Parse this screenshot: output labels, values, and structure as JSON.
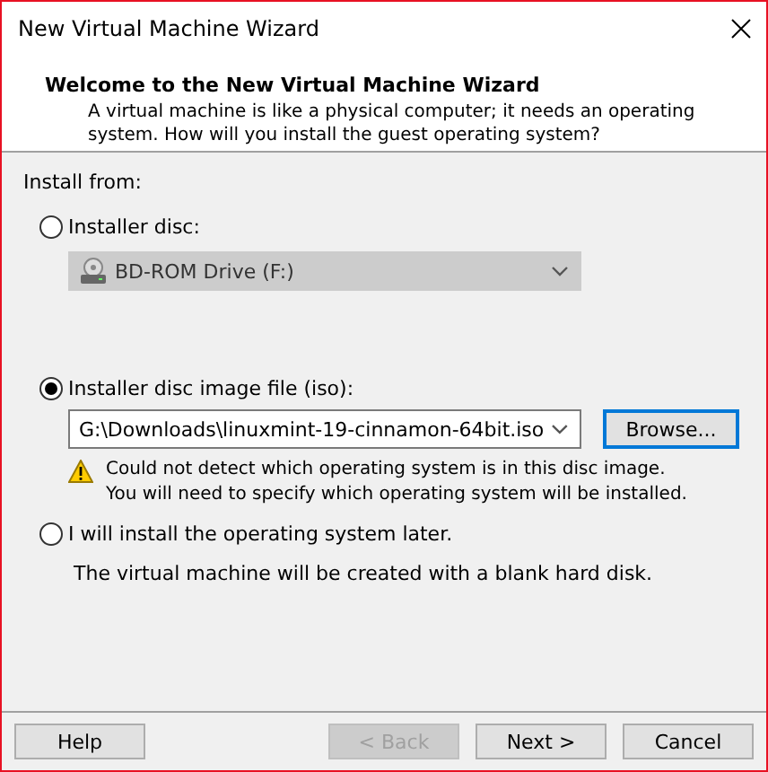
{
  "window": {
    "title": "New Virtual Machine Wizard"
  },
  "header": {
    "title": "Welcome to the New Virtual Machine Wizard",
    "description": "A virtual machine is like a physical computer; it needs an operating system. How will you install the guest operating system?"
  },
  "install_from": {
    "label": "Install from:",
    "options": [
      {
        "kind": "disc",
        "label": "Installer disc:",
        "selected": false,
        "drive": {
          "value": "BD-ROM Drive (F:)",
          "disabled": true
        }
      },
      {
        "kind": "iso",
        "label": "Installer disc image file (iso):",
        "selected": true,
        "path": {
          "value": "G:\\Downloads\\linuxmint-19-cinnamon-64bit.iso"
        },
        "browse": "Browse...",
        "warning": [
          "Could not detect which operating system is in this disc image.",
          "You will need to specify which operating system will be installed."
        ]
      },
      {
        "kind": "later",
        "label": "I will install the operating system later.",
        "selected": false,
        "note": "The virtual machine will be created with a blank hard disk."
      }
    ]
  },
  "buttons": [
    {
      "label": "Help",
      "disabled": false
    },
    {
      "label": "< Back",
      "disabled": true
    },
    {
      "label": "Next >",
      "disabled": false
    },
    {
      "label": "Cancel",
      "disabled": false
    }
  ]
}
